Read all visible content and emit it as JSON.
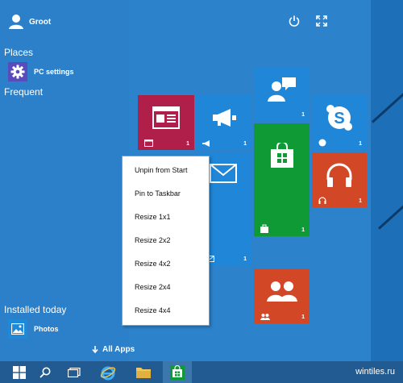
{
  "user": {
    "name": "Groot"
  },
  "sidebar": {
    "places_label": "Places",
    "pc_settings_label": "PC settings",
    "frequent_label": "Frequent",
    "installed_today_label": "Installed today",
    "photos_label": "Photos"
  },
  "all_apps_label": "All Apps",
  "tiles": {
    "news_count": "1",
    "megaphone_count": "1",
    "people_count": "1",
    "skype_count": "1",
    "store_count": "1",
    "music_count": "1",
    "mail_count": "1",
    "family_count": "1"
  },
  "context_menu": {
    "items": [
      "Unpin from Start",
      "Pin to Taskbar",
      "Resize 1x1",
      "Resize 2x2",
      "Resize 4x2",
      "Resize 2x4",
      "Resize 4x4"
    ]
  },
  "watermark": "wintiles.ru",
  "colors": {
    "start_bg": "#2d82cc",
    "tile_news": "#b01e4a",
    "tile_blue": "#1f86d8",
    "tile_store": "#0f9a36",
    "tile_music": "#d24726",
    "tile_family": "#d24726",
    "taskbar": "#225b91"
  }
}
